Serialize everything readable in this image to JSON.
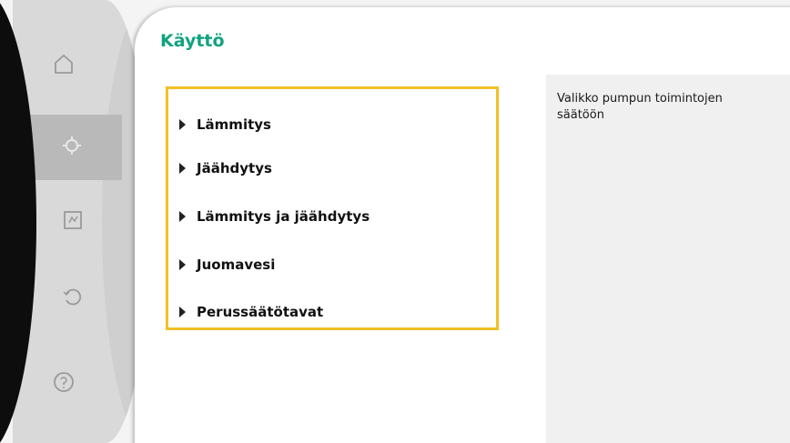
{
  "page": {
    "title": "Käyttö",
    "title_color": "#10a37f"
  },
  "sidebar": {
    "items": [
      {
        "icon": "home-icon",
        "active": false
      },
      {
        "icon": "settings-icon",
        "active": true
      },
      {
        "icon": "diagnostics-icon",
        "active": false
      },
      {
        "icon": "restore-icon",
        "active": false
      },
      {
        "icon": "help-icon",
        "active": false
      }
    ]
  },
  "menu": {
    "highlight_color": "#f2c028",
    "items": [
      {
        "label": "Lämmitys"
      },
      {
        "label": "Jäähdytys"
      },
      {
        "label": "Lämmitys ja jäähdytys"
      },
      {
        "label": "Juomavesi"
      },
      {
        "label": "Perussäätötavat"
      }
    ]
  },
  "help": {
    "text": "Valikko pumpun toimintojen säätöön"
  }
}
